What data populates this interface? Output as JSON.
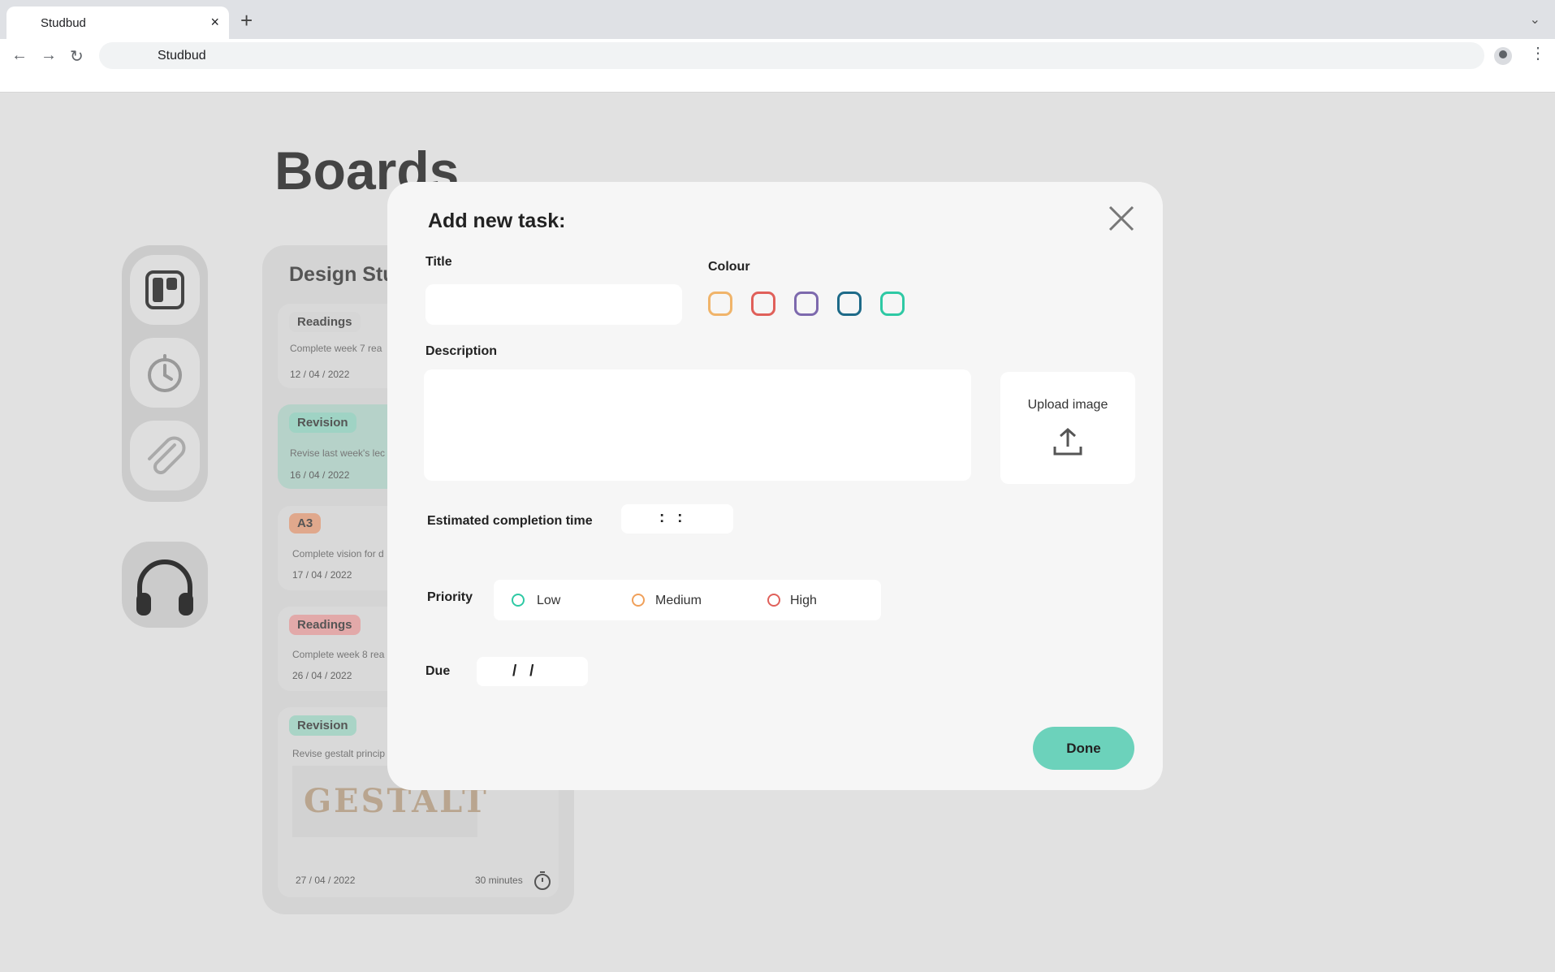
{
  "browser": {
    "tab_title": "Studbud",
    "tab_close": "×",
    "new_tab": "+",
    "tab_menu": "⌄",
    "address": "Studbud",
    "back": "←",
    "forward": "→",
    "reload": "↻",
    "menu": "⋮"
  },
  "page": {
    "title": "Boards",
    "board_title": "Design Stu",
    "cards": [
      {
        "tag": "Readings",
        "desc": "Complete week 7 rea",
        "date": "12 / 04 / 2022",
        "tag_color": "#d6d6d6",
        "card_color": "#d9d9d9"
      },
      {
        "tag": "Revision",
        "desc": "Revise last week's lec",
        "date": "16 / 04 / 2022",
        "tag_color": "#9fd3c4",
        "card_color": "#b6d2c9"
      },
      {
        "tag": "A3",
        "desc": "Complete vision for d",
        "date": "17 / 04 / 2022",
        "tag_color": "#e0a88c",
        "card_color": "#d9d9d9"
      },
      {
        "tag": "Readings",
        "desc": "Complete week 8 rea",
        "date": "26 / 04 / 2022",
        "tag_color": "#e2a9a9",
        "card_color": "#d9d9d9"
      },
      {
        "tag": "Revision",
        "desc": "Revise gestalt princip",
        "date": "27 / 04 / 2022",
        "tag_color": "#a9d4c6",
        "card_color": "#d9d9d9",
        "duration": "30 minutes",
        "image_text": "GESTALT"
      }
    ]
  },
  "modal": {
    "title": "Add new task:",
    "title_label": "Title",
    "title_value": "",
    "colour_label": "Colour",
    "colours": [
      "#f0b46a",
      "#e0605a",
      "#7d69ad",
      "#1d6a88",
      "#2ec9a4"
    ],
    "description_label": "Description",
    "description_value": "",
    "upload_label": "Upload image",
    "estimated_label": "Estimated completion time",
    "time_value": ":   :",
    "priority_label": "Priority",
    "priorities": [
      {
        "label": "Low",
        "color": "#2ec9a4"
      },
      {
        "label": "Medium",
        "color": "#f0a05a"
      },
      {
        "label": "High",
        "color": "#e0605a"
      }
    ],
    "due_label": "Due",
    "due_value": "/   /",
    "done_label": "Done"
  }
}
